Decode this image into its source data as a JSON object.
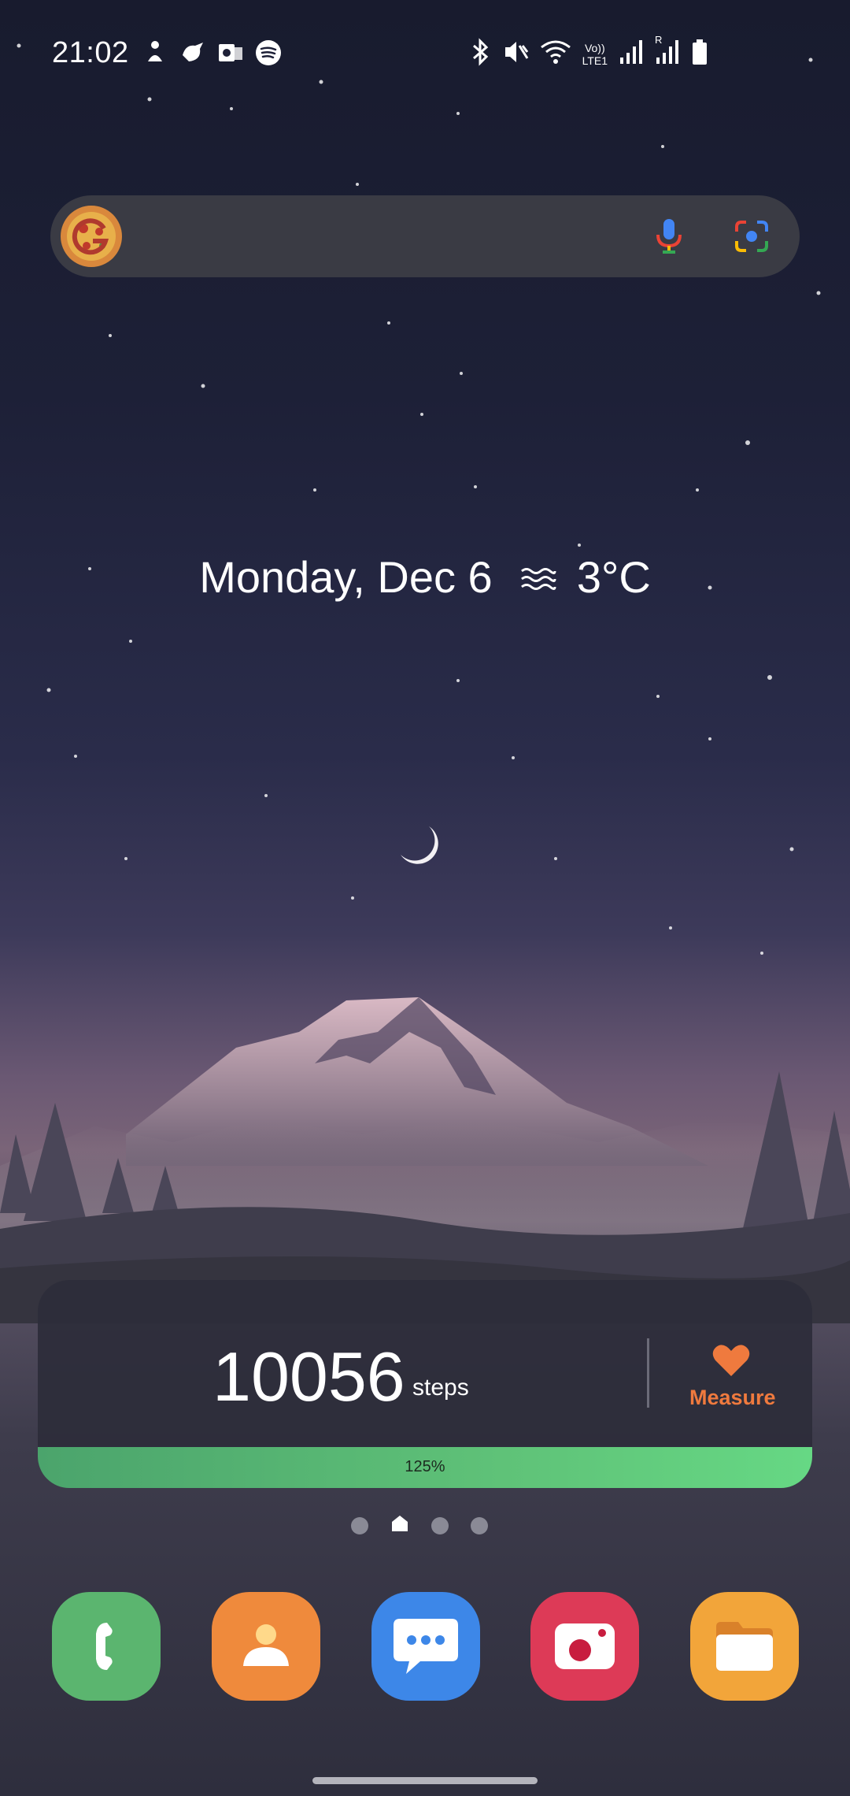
{
  "status_bar": {
    "time": "21:02",
    "notification_icons": [
      "meditation-icon",
      "bird-icon",
      "outlook-icon",
      "spotify-icon"
    ],
    "system_icons": [
      "bluetooth-icon",
      "mute-icon",
      "wifi-icon",
      "volte-icon",
      "signal-icon",
      "roaming-signal-icon",
      "battery-icon"
    ],
    "volte_label": "Vo))",
    "lte_label": "LTE1",
    "roaming_label": "R"
  },
  "search_bar": {
    "logo_icon": "google-doodle-icon",
    "mic_icon": "microphone-icon",
    "lens_icon": "camera-lens-icon"
  },
  "date_weather": {
    "date": "Monday, Dec 6",
    "weather_icon": "fog-icon",
    "temperature": "3°C"
  },
  "steps_widget": {
    "steps": "10056",
    "unit": "steps",
    "measure_label": "Measure",
    "progress_label": "125%",
    "progress_percent": 125,
    "colors": {
      "accent": "#ef7a3e",
      "progress": "#5fc278"
    }
  },
  "page_indicator": {
    "count": 4,
    "current": 1
  },
  "dock": {
    "apps": [
      {
        "name": "Phone",
        "icon": "phone-icon",
        "color": "#5bb56f"
      },
      {
        "name": "Contacts",
        "icon": "contacts-icon",
        "color": "#ef8a3c"
      },
      {
        "name": "Messages",
        "icon": "messages-icon",
        "color": "#3d87e8"
      },
      {
        "name": "Camera",
        "icon": "camera-icon",
        "color": "#dd3a57"
      },
      {
        "name": "My Files",
        "icon": "folder-icon",
        "color": "#f2a53a"
      }
    ]
  }
}
